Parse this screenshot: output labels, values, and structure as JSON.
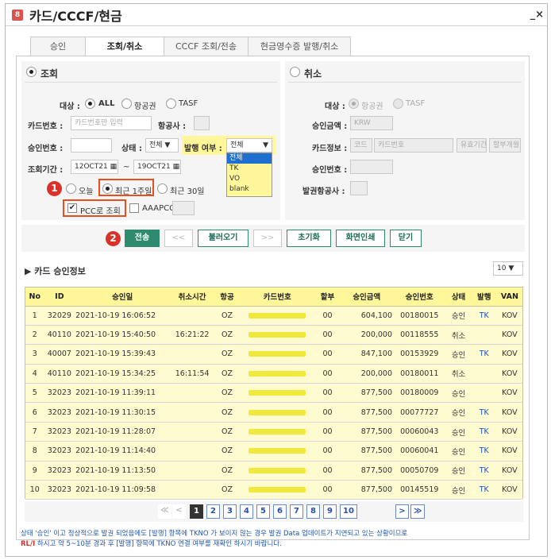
{
  "window": {
    "badge": "8",
    "title": "카드/CCCF/현금",
    "controls": "_×"
  },
  "tabs": [
    "승인",
    "조회/취소",
    "CCCF 조회/전송",
    "현금영수증 발행/취소"
  ],
  "inquiry": {
    "title": "조회",
    "target_label": "대상 :",
    "target_options": [
      "ALL",
      "항공권",
      "TASF"
    ],
    "card_label": "카드번호 :",
    "card_placeholder": "카드번호만 입력",
    "airline_label": "항공사 :",
    "approval_label": "승인번호 :",
    "status_label": "상태 :",
    "status_value": "전체",
    "issue_label": "발행 여부 :",
    "issue_value": "전체",
    "issue_options": [
      "전체",
      "TK",
      "VO",
      "blank"
    ],
    "period_label": "조회기간 :",
    "date_from": "12OCT21",
    "date_sep": "~",
    "date_to": "19OCT21",
    "period_options": [
      "오늘",
      "최근 1주일",
      "최근 30일"
    ],
    "pcc_label": "PCC로 조회",
    "aaapcc_label": "AAAPCC"
  },
  "cancel": {
    "title": "취소",
    "target_label": "대상 :",
    "target_options": [
      "항공권",
      "TASF"
    ],
    "amount_label": "승인금액 :",
    "amount_placeholder": "KRW",
    "cardinfo_label": "카드정보 :",
    "code_placeholder": "코드",
    "cardno_placeholder": "카드번호",
    "expiry_placeholder": "유효기간",
    "installment_placeholder": "할부개월",
    "approval_label": "승인번호 :",
    "airline_label": "발권항공사 :"
  },
  "markers": [
    "1",
    "2"
  ],
  "buttons": {
    "send": "전송",
    "prev": "<<",
    "load": "불러오기",
    "next": ">>",
    "reset": "초기화",
    "print": "화면인쇄",
    "close": "닫기"
  },
  "section_title": "▶ 카드 승인정보",
  "page_size": "10 ▼",
  "columns": [
    "No",
    "ID",
    "승인일",
    "취소시간",
    "항공",
    "카드번호",
    "할부",
    "승인금액",
    "승인번호",
    "상태",
    "발행",
    "VAN"
  ],
  "rows": [
    [
      "1",
      "32029",
      "2021-10-19 16:06:52",
      "",
      "OZ",
      "00",
      "604,100",
      "00180015",
      "승인",
      "TK",
      "KOV"
    ],
    [
      "2",
      "40110",
      "2021-10-19 15:40:50",
      "16:21:22",
      "OZ",
      "00",
      "200,000",
      "00118555",
      "취소",
      "",
      "KOV"
    ],
    [
      "3",
      "40007",
      "2021-10-19 15:39:43",
      "",
      "OZ",
      "00",
      "847,100",
      "00153929",
      "승인",
      "TK",
      "KOV"
    ],
    [
      "4",
      "40110",
      "2021-10-19 15:34:25",
      "16:11:54",
      "OZ",
      "00",
      "200,000",
      "00180011",
      "취소",
      "",
      "KOV"
    ],
    [
      "5",
      "32023",
      "2021-10-19 11:39:11",
      "",
      "OZ",
      "00",
      "877,500",
      "00180009",
      "승인",
      "",
      "KOV"
    ],
    [
      "6",
      "32023",
      "2021-10-19 11:30:15",
      "",
      "OZ",
      "00",
      "877,500",
      "00077727",
      "승인",
      "TK",
      "KOV"
    ],
    [
      "7",
      "32023",
      "2021-10-19 11:28:07",
      "",
      "OZ",
      "00",
      "877,500",
      "00060043",
      "승인",
      "TK",
      "KOV"
    ],
    [
      "8",
      "32023",
      "2021-10-19 11:14:40",
      "",
      "OZ",
      "00",
      "877,500",
      "00060041",
      "승인",
      "TK",
      "KOV"
    ],
    [
      "9",
      "32023",
      "2021-10-19 11:13:50",
      "",
      "OZ",
      "00",
      "877,500",
      "00050709",
      "승인",
      "TK",
      "KOV"
    ],
    [
      "10",
      "32023",
      "2021-10-19 11:09:58",
      "",
      "OZ",
      "00",
      "877,500",
      "00145519",
      "승인",
      "TK",
      "KOV"
    ]
  ],
  "pagination": {
    "first": "≪",
    "prev": "<",
    "pages": [
      "1",
      "2",
      "3",
      "4",
      "5",
      "6",
      "7",
      "8",
      "9",
      "10"
    ],
    "next": ">",
    "last": "≫"
  },
  "notice": {
    "line1": "상태 '승인' 이고 정상적으로 발권 되었음에도 [발행] 항목에 TKNO 가 보이지 않는 경우 발권 Data 업데이트가 지연되고 있는 상황이므로",
    "line2_prefix": "RL/I",
    "line2": " 하시고 약 5~10분 경과 후 [발행] 항목에 TKNO 연결 여부를 재확인 하시기 바랍니다."
  },
  "colors": {
    "accent": "#2e8b6f",
    "highlight": "#fff79a",
    "marker": "#d8322b",
    "masked_card": "#f0e83a"
  }
}
